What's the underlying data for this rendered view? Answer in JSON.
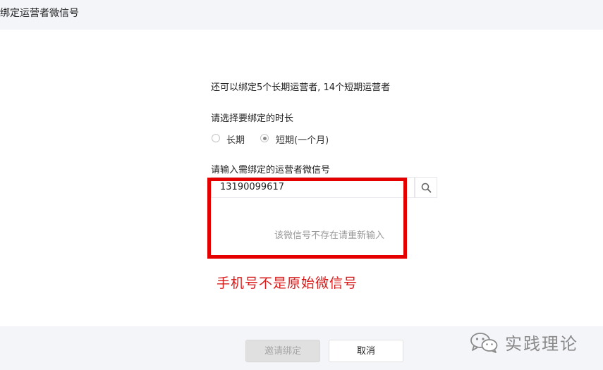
{
  "header": {
    "title": "绑定运营者微信号"
  },
  "form": {
    "quota_text": "还可以绑定5个长期运营者, 14个短期运营者",
    "duration_label": "请选择要绑定的时长",
    "duration_options": [
      {
        "label": "长期",
        "checked": false
      },
      {
        "label": "短期(一个月)",
        "checked": true
      }
    ],
    "wechat_label": "请输入需绑定的运营者微信号",
    "search": {
      "value": "13190099617",
      "icon": "search-icon"
    },
    "result_message": "该微信号不存在请重新输入"
  },
  "annotation": {
    "text": "手机号不是原始微信号",
    "color": "#e50000"
  },
  "footer": {
    "invite_label": "邀请绑定",
    "cancel_label": "取消"
  },
  "watermark": {
    "text": "实践理论",
    "icon": "wechat-icon"
  }
}
